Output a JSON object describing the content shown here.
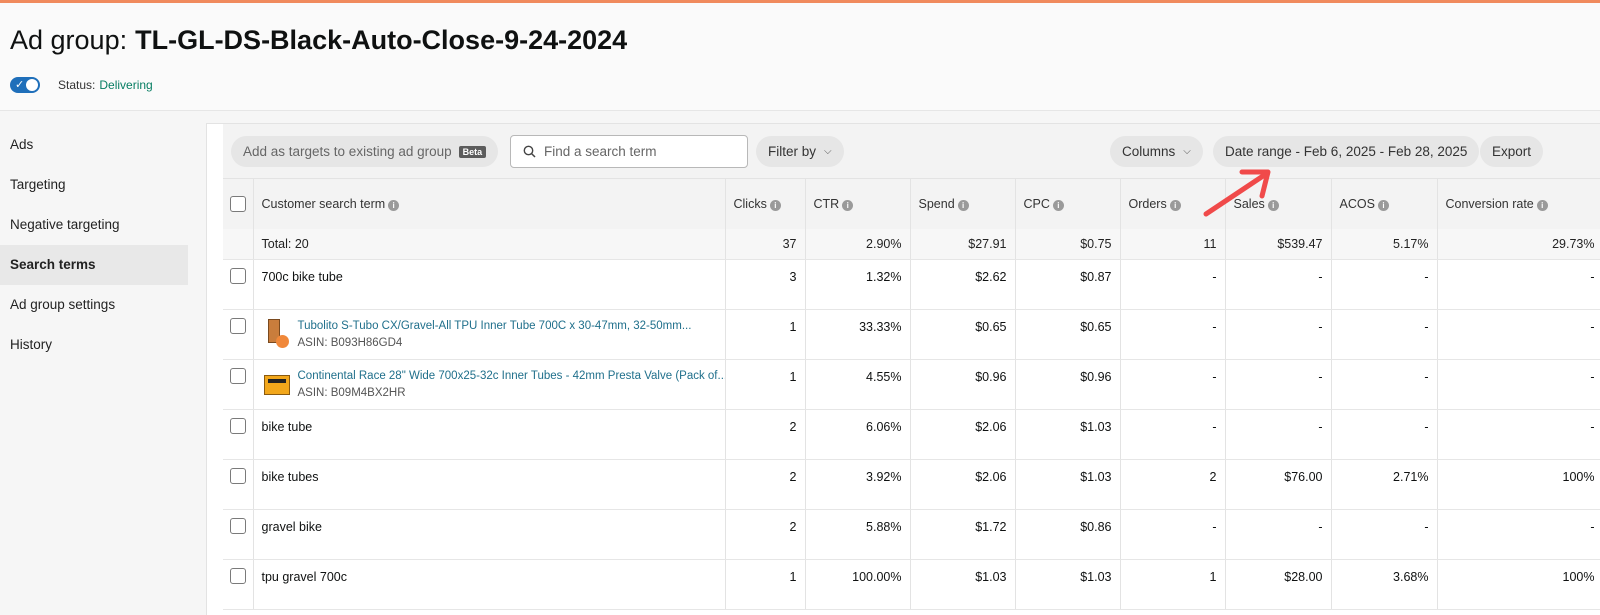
{
  "header": {
    "title_prefix": "Ad group:",
    "ad_group_name": "TL-GL-DS-Black-Auto-Close-9-24-2024",
    "status_label": "Status:",
    "status_value": "Delivering"
  },
  "sidebar": {
    "items": [
      {
        "label": "Ads"
      },
      {
        "label": "Targeting"
      },
      {
        "label": "Negative targeting"
      },
      {
        "label": "Search terms"
      },
      {
        "label": "Ad group settings"
      },
      {
        "label": "History"
      }
    ],
    "active": "Search terms"
  },
  "toolbar": {
    "add_targets_label": "Add as targets to existing ad group",
    "beta_badge": "Beta",
    "search_placeholder": "Find a search term",
    "filter_label": "Filter by",
    "columns_label": "Columns",
    "date_range_label": "Date range - Feb 6, 2025 - Feb 28, 2025",
    "export_label": "Export"
  },
  "table": {
    "headers": {
      "term": "Customer search term",
      "clicks": "Clicks",
      "ctr": "CTR",
      "spend": "Spend",
      "cpc": "CPC",
      "orders": "Orders",
      "sales": "Sales",
      "acos": "ACOS",
      "conv": "Conversion rate"
    },
    "total": {
      "label": "Total: 20",
      "clicks": "37",
      "ctr": "2.90%",
      "spend": "$27.91",
      "cpc": "$0.75",
      "orders": "11",
      "sales": "$539.47",
      "acos": "5.17%",
      "conv": "29.73%"
    },
    "rows": [
      {
        "term": "700c bike tube",
        "clicks": "3",
        "ctr": "1.32%",
        "spend": "$2.62",
        "cpc": "$0.87",
        "orders": "-",
        "sales": "-",
        "acos": "-",
        "conv": "-"
      },
      {
        "product_title": "Tubolito S-Tubo CX/Gravel-All TPU Inner Tube 700C x 30-47mm, 32-50mm...",
        "asin": "ASIN: B093H86GD4",
        "clicks": "1",
        "ctr": "33.33%",
        "spend": "$0.65",
        "cpc": "$0.65",
        "orders": "-",
        "sales": "-",
        "acos": "-",
        "conv": "-"
      },
      {
        "product_title": "Continental Race 28\" Wide 700x25-32c Inner Tubes - 42mm Presta Valve (Pack of...",
        "asin": "ASIN: B09M4BX2HR",
        "clicks": "1",
        "ctr": "4.55%",
        "spend": "$0.96",
        "cpc": "$0.96",
        "orders": "-",
        "sales": "-",
        "acos": "-",
        "conv": "-"
      },
      {
        "term": "bike tube",
        "clicks": "2",
        "ctr": "6.06%",
        "spend": "$2.06",
        "cpc": "$1.03",
        "orders": "-",
        "sales": "-",
        "acos": "-",
        "conv": "-"
      },
      {
        "term": "bike tubes",
        "clicks": "2",
        "ctr": "3.92%",
        "spend": "$2.06",
        "cpc": "$1.03",
        "orders": "2",
        "sales": "$76.00",
        "acos": "2.71%",
        "conv": "100%"
      },
      {
        "term": "gravel bike",
        "clicks": "2",
        "ctr": "5.88%",
        "spend": "$1.72",
        "cpc": "$0.86",
        "orders": "-",
        "sales": "-",
        "acos": "-",
        "conv": "-"
      },
      {
        "term": "tpu gravel 700c",
        "clicks": "1",
        "ctr": "100.00%",
        "spend": "$1.03",
        "cpc": "$1.03",
        "orders": "1",
        "sales": "$28.00",
        "acos": "3.68%",
        "conv": "100%"
      }
    ]
  },
  "colors": {
    "accent_top_bar": "#f08a5d",
    "toggle_blue": "#1f6fba",
    "status_green": "#067d62",
    "link_teal": "#1f6f8b",
    "annotation_arrow": "#f04a4a"
  }
}
